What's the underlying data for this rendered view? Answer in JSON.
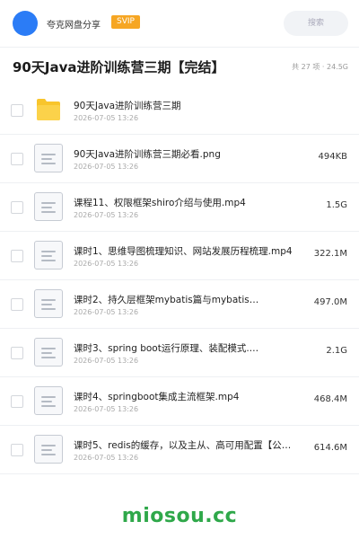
{
  "header": {
    "brand": "夸克网盘分享",
    "badge": "SVIP",
    "search_placeholder": "搜索"
  },
  "folder": {
    "title": "90天Java进阶训练营三期【完结】",
    "summary": "共 27 项 · 24.5G"
  },
  "items": [
    {
      "name": "90天Java进阶训练营三期",
      "date": "2026-07-05 13:26",
      "size": "",
      "icon": "folder-icon"
    },
    {
      "name": "90天Java进阶训练营三期必看.png",
      "date": "2026-07-05 13:26",
      "size": "494KB",
      "icon": "file-icon"
    },
    {
      "name": "课程11、权限框架shiro介绍与使用.mp4",
      "date": "2026-07-05 13:26",
      "size": "1.5G",
      "icon": "file-icon"
    },
    {
      "name": "课时1、思维导图梳理知识、网站发展历程梳理.mp4",
      "date": "2026-07-05 13:26",
      "size": "322.1M",
      "icon": "file-icon"
    },
    {
      "name": "课时2、持久层框架mybatis篇与mybatis…",
      "date": "2026-07-05 13:26",
      "size": "497.0M",
      "icon": "file-icon"
    },
    {
      "name": "课时3、spring boot运行原理、装配模式.…",
      "date": "2026-07-05 13:26",
      "size": "2.1G",
      "icon": "file-icon"
    },
    {
      "name": "课时4、springboot集成主流框架.mp4",
      "date": "2026-07-05 13:26",
      "size": "468.4M",
      "icon": "file-icon"
    },
    {
      "name": "课时5、redis的缓存，以及主从、高可用配置【公…",
      "date": "2026-07-05 13:26",
      "size": "614.6M",
      "icon": "file-icon"
    }
  ],
  "watermark": "miosou.cc",
  "colors": {
    "avatar": "#2b7cf6",
    "badge": "#f6a623",
    "folder": "#f8c52c",
    "watermark": "#2fa84a"
  }
}
